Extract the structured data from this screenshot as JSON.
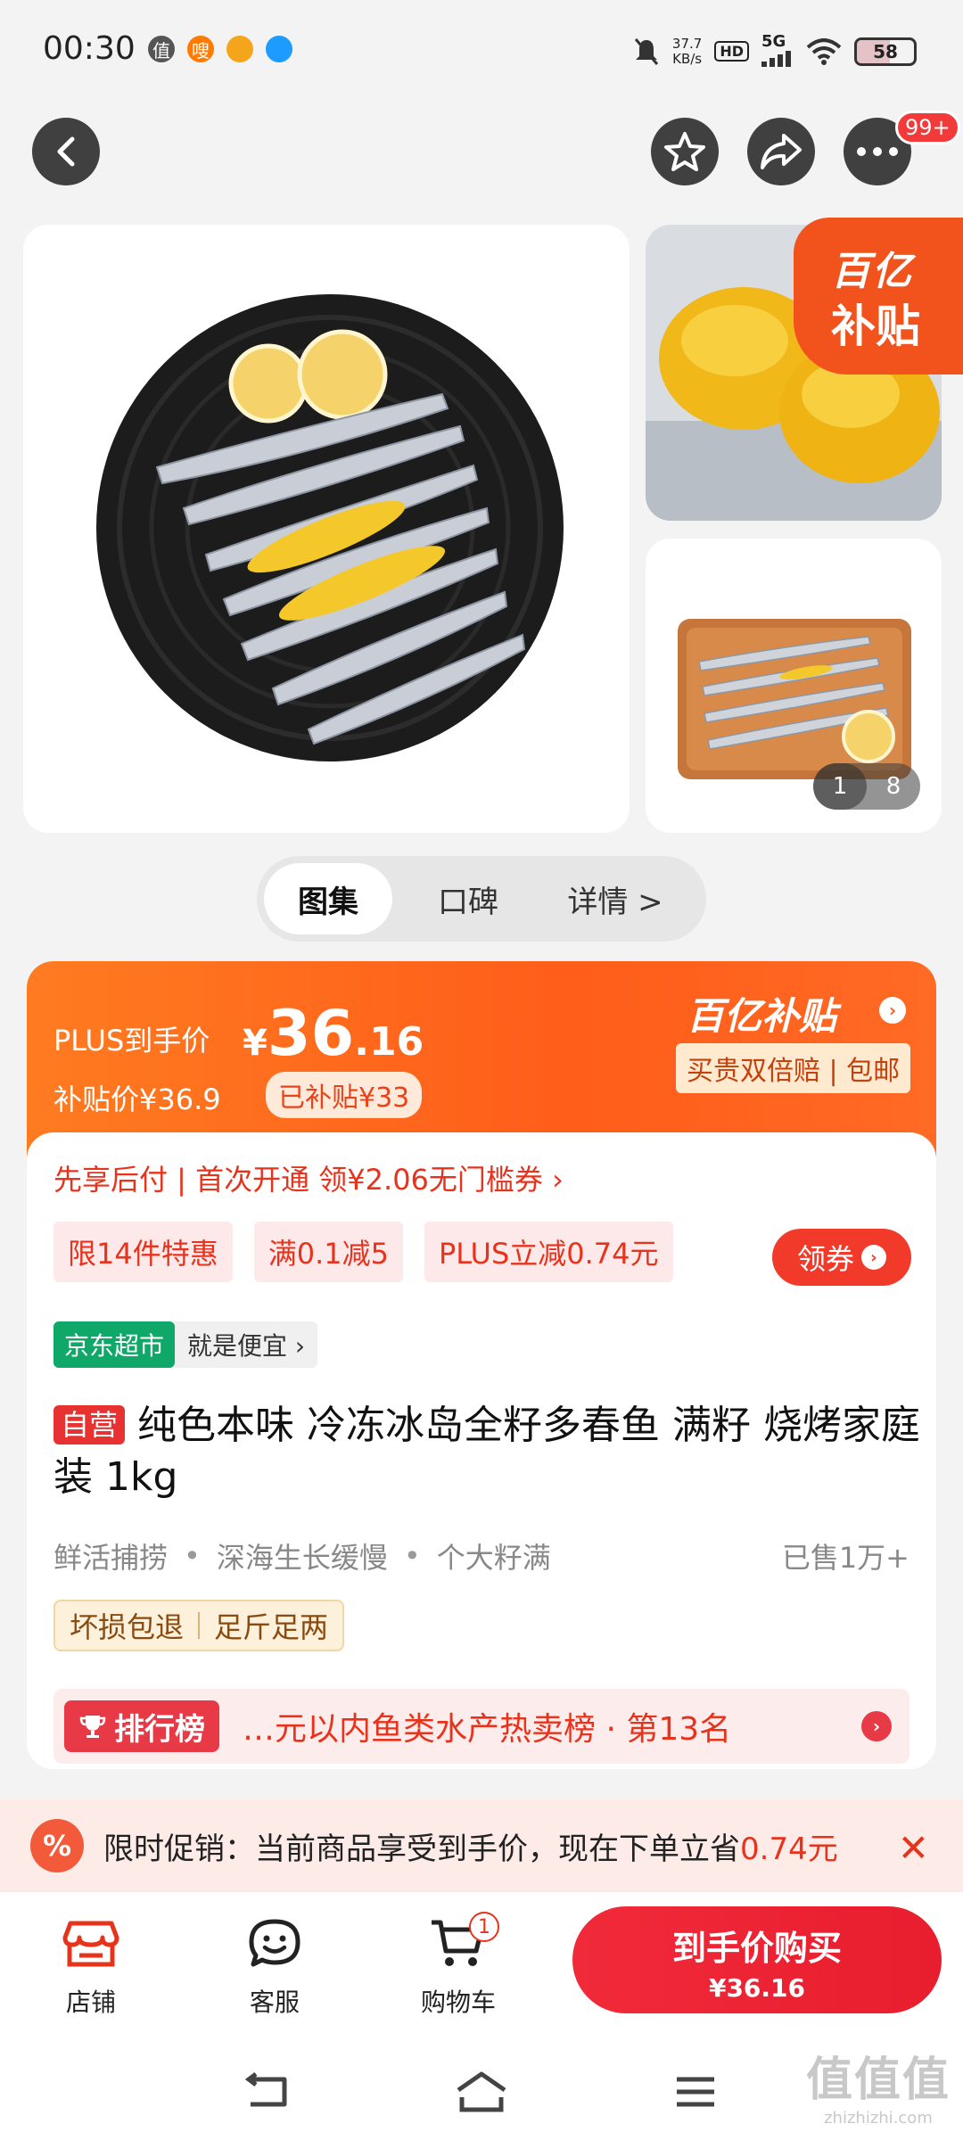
{
  "status_bar": {
    "time": "00:30",
    "app_icons": [
      "值",
      "嗖",
      "猫",
      "企鹅"
    ],
    "net_speed": "37.7",
    "net_unit": "KB/s",
    "hd": "HD",
    "signal": "5G",
    "battery": "58",
    "battery_level": 0.58
  },
  "top_nav": {
    "more_badge": "99+"
  },
  "gallery": {
    "subsidy_tag_line1": "百亿",
    "subsidy_tag_line2": "补贴",
    "counter_current": "1",
    "counter_total": "8"
  },
  "tabs": [
    {
      "label": "图集",
      "active": true
    },
    {
      "label": "口碑",
      "active": false
    },
    {
      "label": "详情 >",
      "active": false
    }
  ],
  "price": {
    "plus_label": "PLUS到手价",
    "currency": "¥",
    "integer": "36",
    "decimal": ".16",
    "subsidy_price": "补贴价¥36.9",
    "subsidized": "已补贴¥33",
    "brand": "百亿补贴",
    "guarantee": "买贵双倍赔 | 包邮"
  },
  "promo_line": "先享后付 | 首次开通 领¥2.06无门槛券 ›",
  "coupons": [
    "限14件特惠",
    "满0.1减5",
    "PLUS立减0.74元"
  ],
  "get_coupon": "领券",
  "store": {
    "tag": "京东超市",
    "slogan": "就是便宜 ›"
  },
  "product": {
    "self_tag": "自营",
    "title": "纯色本味 冷冻冰岛全籽多春鱼 满籽 烧烤家庭装 1kg",
    "features": [
      "鲜活捕捞",
      "深海生长缓慢",
      "个大籽满"
    ],
    "sold": "已售1万+",
    "services": [
      "坏损包退",
      "足斤足两"
    ]
  },
  "ranking": {
    "tag": "排行榜",
    "text": "…元以内鱼类水产热卖榜 · 第13名"
  },
  "limited_promo": {
    "icon": "%",
    "text": "限时促销：当前商品享受到手价，现在下单立省",
    "amount": "0.74元",
    "close": "✕"
  },
  "bottom_bar": {
    "shop": "店铺",
    "service": "客服",
    "cart": "购物车",
    "cart_count": "1",
    "buy_label": "到手价购买",
    "buy_price": "¥36.16"
  },
  "watermark": {
    "line1": "值值值",
    "line2": "zhizhizhi.com"
  },
  "colors": {
    "accent_orange": "#ff5d1a",
    "accent_red": "#e8331c",
    "jd_green": "#0fa869"
  }
}
